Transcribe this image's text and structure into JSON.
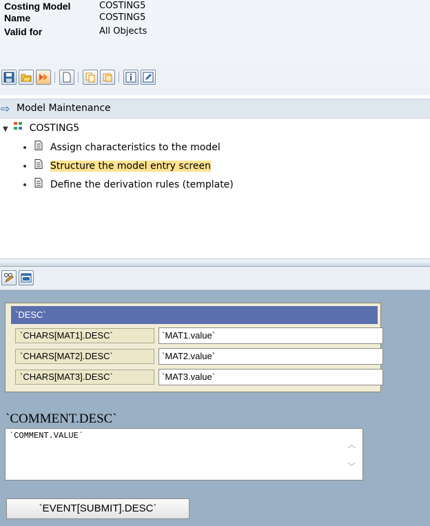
{
  "header": {
    "rows": [
      {
        "label": "Costing Model",
        "value": "COSTING5"
      },
      {
        "label": "Name",
        "value": "COSTING5"
      },
      {
        "label": "Valid for",
        "value": "All Objects"
      }
    ]
  },
  "toolbar": {
    "icons": [
      "save-icon",
      "open-folder-icon",
      "transport-icon",
      "new-document-icon",
      "copy-icon",
      "info-icon",
      "edit-icon"
    ]
  },
  "tree": {
    "header": "Model Maintenance",
    "root": "COSTING5",
    "items": [
      {
        "label": "Assign characteristics to the model",
        "selected": false
      },
      {
        "label": "Structure the model entry screen",
        "selected": true
      },
      {
        "label": "Define the derivation rules (template)",
        "selected": false
      }
    ]
  },
  "preview_toolbar": {
    "icons": [
      "glasses-edit-icon",
      "window-icon"
    ]
  },
  "form": {
    "header": "`DESC`",
    "rows": [
      {
        "label": "`CHARS[MAT1].DESC`",
        "value": "`MAT1.value`"
      },
      {
        "label": "`CHARS[MAT2].DESC`",
        "value": "`MAT2.value`"
      },
      {
        "label": "`CHARS[MAT3].DESC`",
        "value": "`MAT3.value`"
      }
    ],
    "comment_label": "`COMMENT.DESC`",
    "comment_value": "`COMMENT.VALUE`",
    "submit_label": "`EVENT[SUBMIT].DESC`"
  },
  "colors": {
    "highlight": "#ffe28f",
    "form_header": "#5b6fae",
    "preview_bg": "#9ab0c4"
  }
}
